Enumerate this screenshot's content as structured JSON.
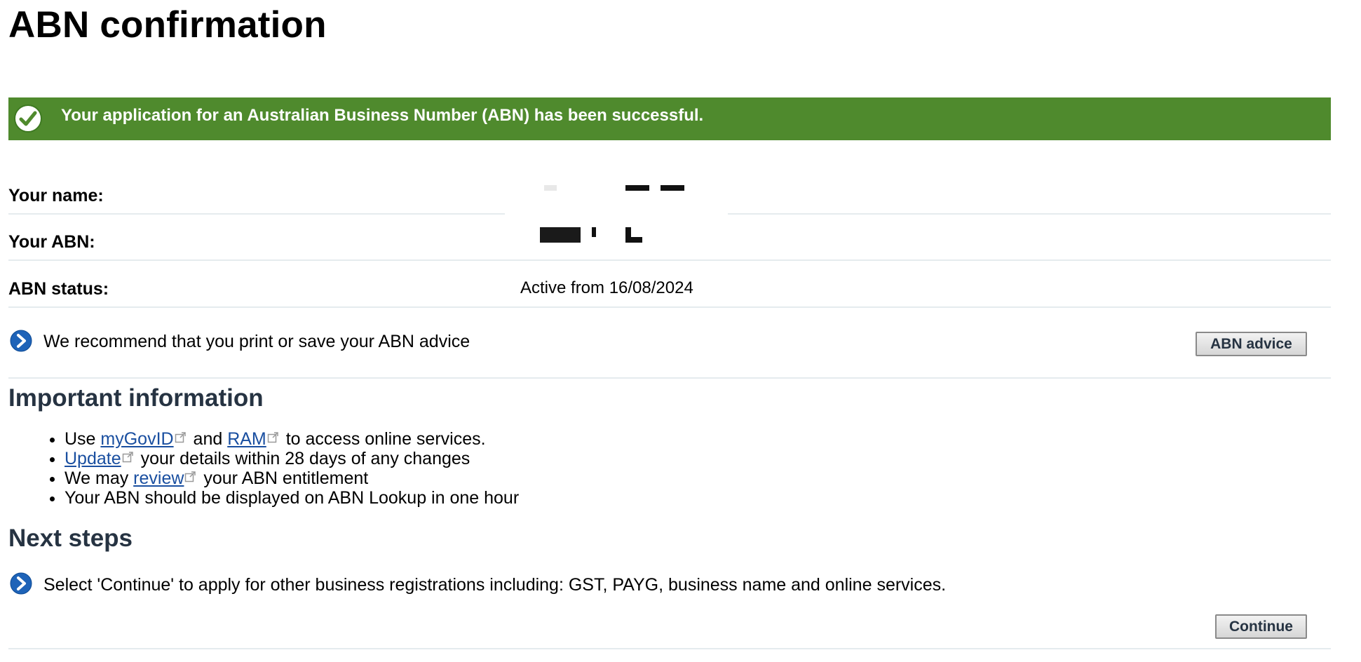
{
  "page": {
    "title": "ABN confirmation"
  },
  "banner": {
    "message": "Your application for an Australian Business Number (ABN) has been successful.",
    "color": "#4f8a2d",
    "icon": "check-circle-icon"
  },
  "details": {
    "name_label": "Your name:",
    "abn_label": "Your ABN:",
    "status_label": "ABN status:",
    "status_value": "Active from 16/08/2024"
  },
  "advice": {
    "text": "We recommend that you print or save your ABN advice",
    "button_label": "ABN advice",
    "icon": "chevron-right-icon"
  },
  "important": {
    "heading": "Important information",
    "items": [
      {
        "pre": "Use ",
        "link1": "myGovID",
        "mid": " and ",
        "link2": "RAM",
        "post": " to access online services."
      },
      {
        "link": "Update",
        "post": " your details within 28 days of any changes"
      },
      {
        "pre": "We may ",
        "link": "review",
        "post": " your ABN entitlement"
      },
      {
        "text": "Your ABN should be displayed on ABN Lookup in one hour"
      }
    ],
    "link_color": "#1a4fa0"
  },
  "next_steps": {
    "heading": "Next steps",
    "text": "Select 'Continue' to apply for other business registrations including: GST, PAYG, business name and online services.",
    "button_label": "Continue",
    "icon": "chevron-right-icon"
  }
}
